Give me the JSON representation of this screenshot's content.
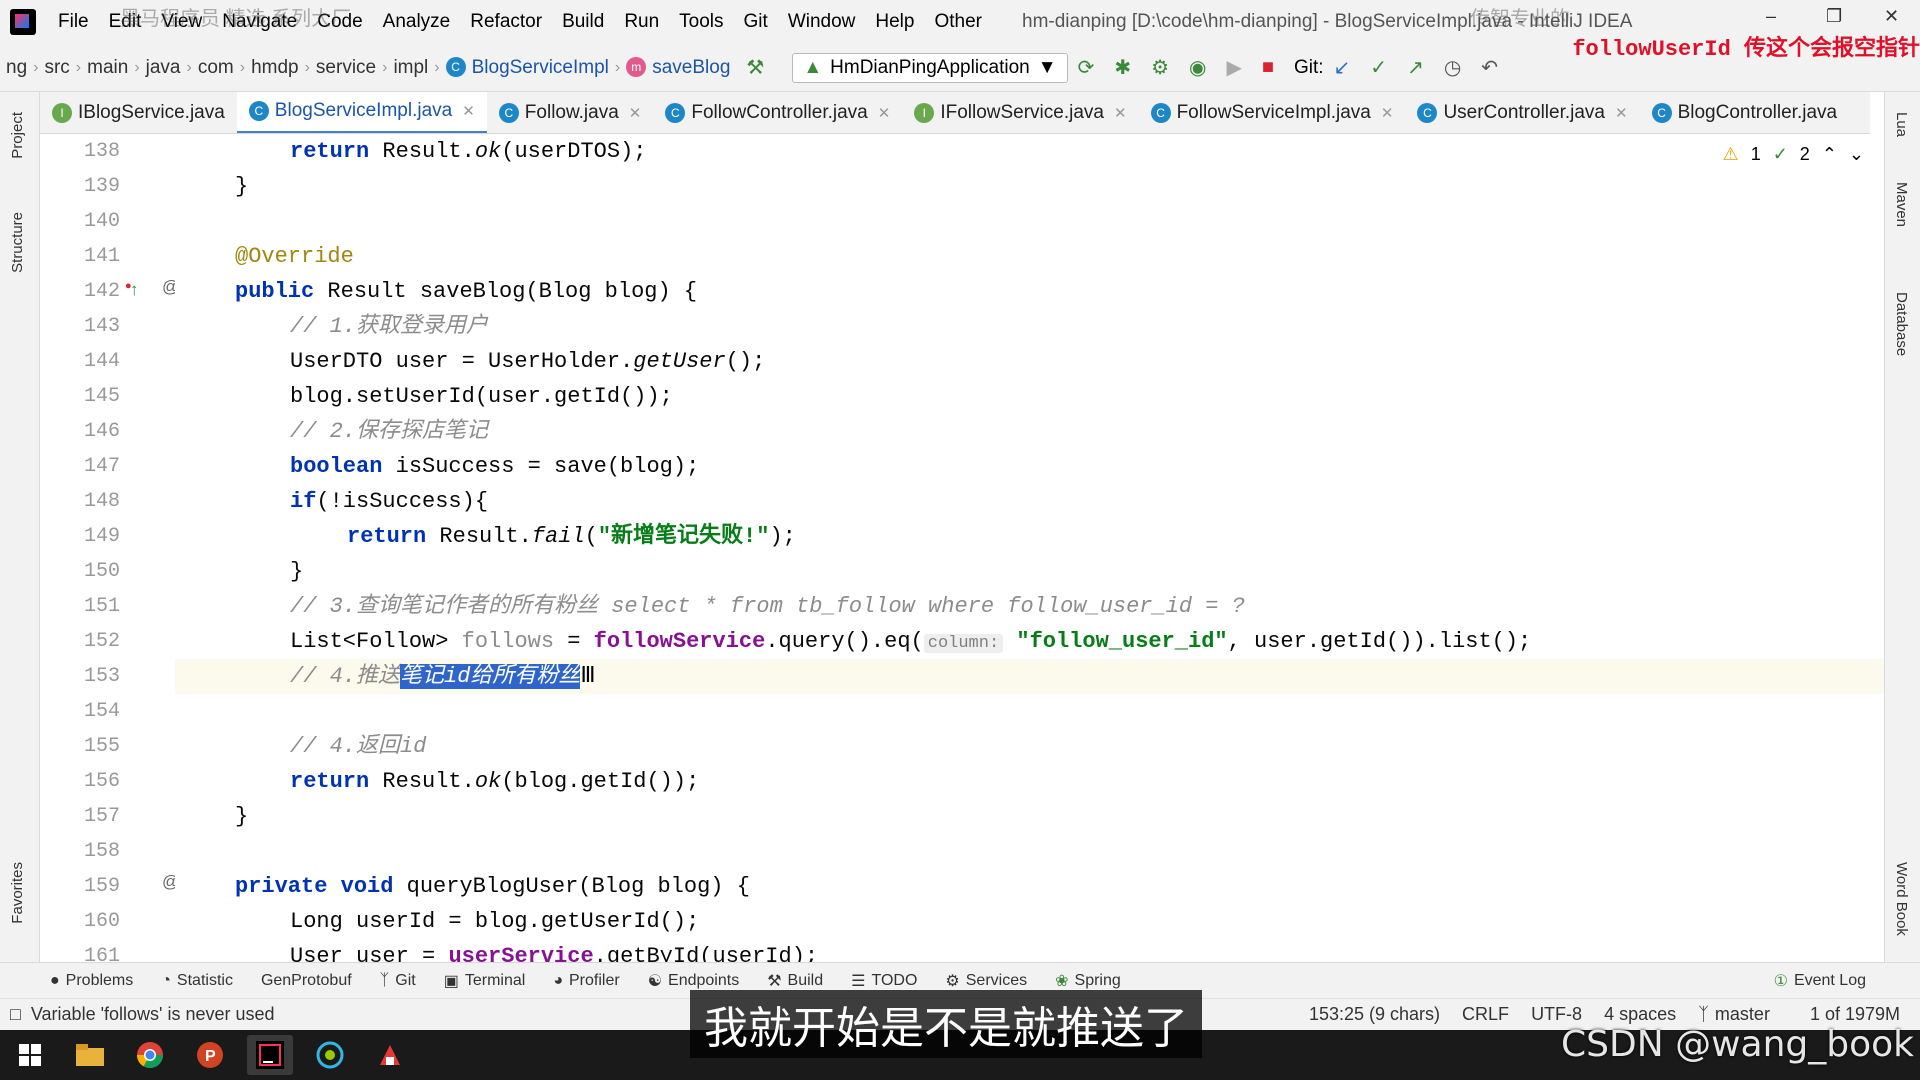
{
  "menubar": {
    "items": [
      "File",
      "Edit",
      "View",
      "Navigate",
      "Code",
      "Analyze",
      "Refactor",
      "Build",
      "Run",
      "Tools",
      "Git",
      "Window",
      "Help",
      "Other"
    ],
    "window_title": "hm-dianping [D:\\code\\hm-dianping] - BlogServiceImpl.java - IntelliJ IDEA",
    "overlay_top_left": "黑马程序员 精选 系列大厂",
    "overlay_top_right": "传智专业的"
  },
  "navbar": {
    "crumbs": [
      "ng",
      "src",
      "main",
      "java",
      "com",
      "hmdp",
      "service",
      "impl"
    ],
    "class_crumb": "BlogServiceImpl",
    "method_crumb": "saveBlog",
    "run_config": "HmDianPingApplication",
    "git_label": "Git:"
  },
  "overlay_red": "followUserId 传这个会报空指针",
  "tabs": [
    {
      "label": "IBlogService.java",
      "icon": "I"
    },
    {
      "label": "BlogServiceImpl.java",
      "icon": "C"
    },
    {
      "label": "Follow.java",
      "icon": "C"
    },
    {
      "label": "FollowController.java",
      "icon": "C"
    },
    {
      "label": "IFollowService.java",
      "icon": "I"
    },
    {
      "label": "FollowServiceImpl.java",
      "icon": "C"
    },
    {
      "label": "UserController.java",
      "icon": "C"
    },
    {
      "label": "BlogController.java",
      "icon": "C"
    }
  ],
  "left_tools": [
    "Project",
    "Structure",
    "Favorites"
  ],
  "right_tools": [
    "Lua",
    "Maven",
    "Database",
    "Word Book"
  ],
  "inspections": {
    "warnings": "1",
    "weak": "2"
  },
  "editor": {
    "line_numbers": [
      "138",
      "139",
      "140",
      "141",
      "142",
      "143",
      "144",
      "145",
      "146",
      "147",
      "148",
      "149",
      "150",
      "151",
      "152",
      "153",
      "154",
      "155",
      "156",
      "157",
      "158",
      "159",
      "160",
      "161"
    ],
    "l138": {
      "kw": "return",
      "rest_a": " Result.",
      "it": "ok",
      "rest_b": "(userDTOS);"
    },
    "l139": "}",
    "l141": "@Override",
    "l142": {
      "kw": "public",
      "rest": " Result saveBlog(Blog blog) {"
    },
    "l143": "// 1.获取登录用户",
    "l144": {
      "a": "UserDTO user = UserHolder.",
      "it": "getUser",
      "b": "();"
    },
    "l145": "blog.setUserId(user.getId());",
    "l146": "// 2.保存探店笔记",
    "l147": {
      "kw": "boolean",
      "rest": " isSuccess = save(blog);"
    },
    "l148": {
      "kw": "if",
      "rest": "(!isSuccess){"
    },
    "l149": {
      "kw": "return",
      "a": " Result.",
      "it": "fail",
      "b": "(",
      "str": "\"新增笔记失败!\"",
      "c": ");"
    },
    "l150": "}",
    "l151": "// 3.查询笔记作者的所有粉丝 select * from tb_follow where follow_user_id = ?",
    "l152": {
      "a": "List<Follow> ",
      "unused": "follows",
      "b": " = ",
      "fld": "followService",
      "c": ".query().eq(",
      "hint": "column:",
      "str": " \"follow_user_id\"",
      "d": ", user.getId()).list();"
    },
    "l153": {
      "cm": "// 4.推送",
      "sel": "笔记id给所有粉丝"
    },
    "l155": "// 4.返回id",
    "l156": {
      "kw": "return",
      "a": " Result.",
      "it": "ok",
      "b": "(blog.getId());"
    },
    "l157": "}",
    "l159": {
      "kw1": "private",
      "kw2": "void",
      "rest": " queryBlogUser(Blog blog) {"
    },
    "l160": "Long userId = blog.getUserId();",
    "l161": {
      "a": "User user = ",
      "fld": "userService",
      "b": ".getById(userId);"
    }
  },
  "bottom_tabs": [
    "Problems",
    "Statistic",
    "GenProtobuf",
    "Git",
    "Terminal",
    "Profiler",
    "Endpoints",
    "Build",
    "TODO",
    "Services",
    "Spring",
    "Event Log"
  ],
  "statusbar": {
    "message": "Variable 'follows' is never used",
    "position": "153:25 (9 chars)",
    "line_sep": "CRLF",
    "encoding": "UTF-8",
    "indent": "4 spaces",
    "branch": "master",
    "memory": "1 of 1979M"
  },
  "subtitle": "我就开始是不是就推送了",
  "watermark": "CSDN @wang_book"
}
